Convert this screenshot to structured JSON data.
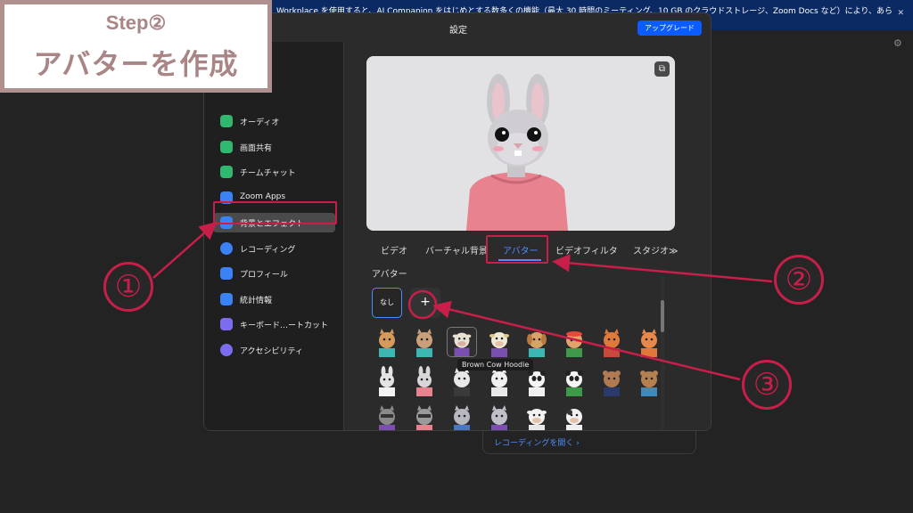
{
  "banner": {
    "text": "Workplace を使用すると、AI Companion をはじめとする数多くの機能（最大 30 時間のミーティング、10 GB のクラウドストレージ、Zoom Docs など）により、あらゆる業務を効率化",
    "close_icon": "close-icon"
  },
  "step": {
    "title": "Step②",
    "subtitle": "アバターを作成"
  },
  "window": {
    "title": "設定",
    "upgrade_label": "アップグレード"
  },
  "sidebar": {
    "items": [
      {
        "label": "オーディオ",
        "icon": "headphones-icon",
        "color": "#2fb86e"
      },
      {
        "label": "画面共有",
        "icon": "screen-share-icon",
        "color": "#2fb86e"
      },
      {
        "label": "チームチャット",
        "icon": "chat-icon",
        "color": "#2fb86e"
      },
      {
        "label": "Zoom Apps",
        "icon": "apps-icon",
        "color": "#3b82f6"
      },
      {
        "label": "背景とエフェクト",
        "icon": "background-icon",
        "color": "#3b82f6"
      },
      {
        "label": "レコーディング",
        "icon": "record-icon",
        "color": "#3b82f6"
      },
      {
        "label": "プロフィール",
        "icon": "profile-icon",
        "color": "#3b82f6"
      },
      {
        "label": "統計情報",
        "icon": "stats-icon",
        "color": "#3b82f6"
      },
      {
        "label": "キーボード…ートカット",
        "icon": "keyboard-icon",
        "color": "#7c6cf0"
      },
      {
        "label": "アクセシビリティ",
        "icon": "accessibility-icon",
        "color": "#7c6cf0"
      }
    ],
    "active_index": 4
  },
  "tabs": [
    {
      "label": "ビデオ"
    },
    {
      "label": "バーチャル背景"
    },
    {
      "label": "アバター"
    },
    {
      "label": "ビデオフィルタ"
    },
    {
      "label": "スタジオ≫"
    }
  ],
  "active_tab": 2,
  "section_label": "アバター",
  "avatars": {
    "none_label": "なし",
    "add_label": "+",
    "tooltip": "Brown Cow Hoodie"
  },
  "recording_link": "レコーディングを開く ›",
  "annotations": {
    "one": "①",
    "two": "②",
    "three": "③"
  },
  "colors": {
    "accent": "#0b5cff",
    "annotation": "#c81e4a",
    "step": "#a98585"
  }
}
